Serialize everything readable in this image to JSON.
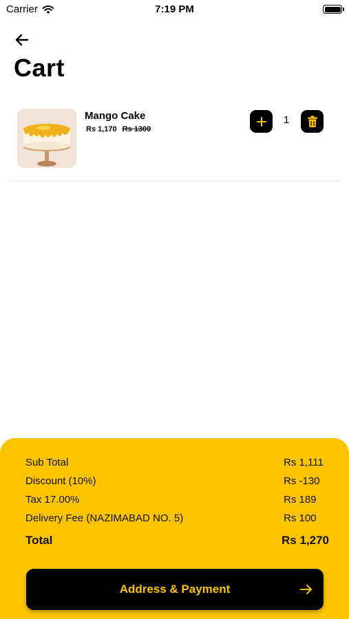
{
  "status_bar": {
    "carrier": "Carrier",
    "time": "7:19 PM"
  },
  "header": {
    "title": "Cart"
  },
  "cart": {
    "items": [
      {
        "name": "Mango Cake",
        "price": "Rs 1,170",
        "original_price": "Rs 1300",
        "quantity": "1"
      }
    ]
  },
  "summary": {
    "subtotal_label": "Sub Total",
    "subtotal_value": "Rs 1,111",
    "discount_label": "Discount (10%)",
    "discount_value": "Rs -130",
    "tax_label": "Tax 17.00%",
    "tax_value": "Rs 189",
    "delivery_label": "Delivery Fee (NAZIMABAD NO. 5)",
    "delivery_value": "Rs 100",
    "total_label": "Total",
    "total_value": "Rs 1,270"
  },
  "checkout": {
    "label": "Address & Payment"
  },
  "colors": {
    "accent": "#fcc400",
    "button": "#000000"
  },
  "icons": {
    "back": "arrow-left-icon",
    "plus": "plus-icon",
    "delete": "trash-icon",
    "proceed": "arrow-right-icon"
  }
}
